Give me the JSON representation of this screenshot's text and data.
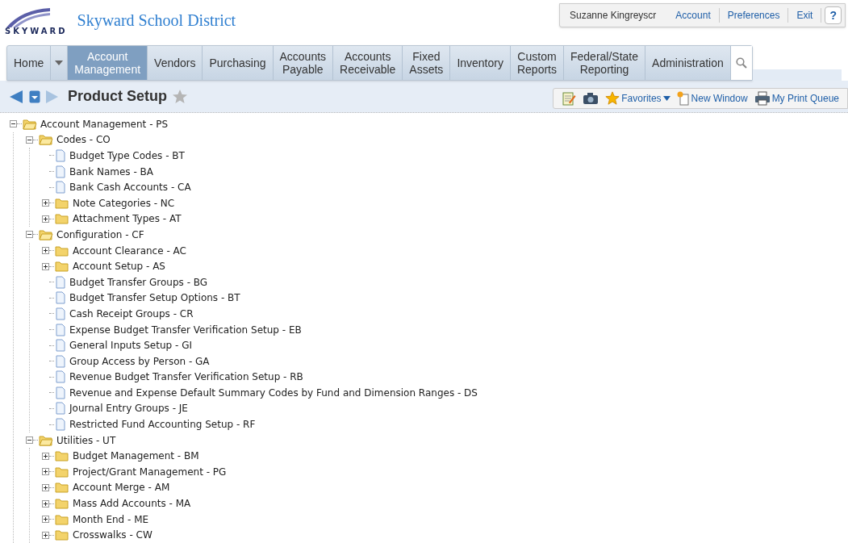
{
  "header": {
    "district": "Skyward School District",
    "logo_text": "SKYWARD",
    "user": "Suzanne Kingreyscr",
    "links": [
      "Account",
      "Preferences",
      "Exit"
    ],
    "help": "?"
  },
  "nav": {
    "tabs": [
      {
        "label": "Home",
        "selected": false,
        "dropdown": true
      },
      {
        "label": "Account Management",
        "selected": true
      },
      {
        "label": "Vendors",
        "selected": false
      },
      {
        "label": "Purchasing",
        "selected": false
      },
      {
        "label": "Accounts Payable",
        "selected": false
      },
      {
        "label": "Accounts Receivable",
        "selected": false
      },
      {
        "label": "Fixed Assets",
        "selected": false
      },
      {
        "label": "Inventory",
        "selected": false
      },
      {
        "label": "Custom Reports",
        "selected": false
      },
      {
        "label": "Federal/State Reporting",
        "selected": false
      },
      {
        "label": "Administration",
        "selected": false
      }
    ]
  },
  "page": {
    "title": "Product Setup",
    "favorited": false
  },
  "toolbar": [
    {
      "kind": "notes"
    },
    {
      "kind": "camera"
    },
    {
      "kind": "favorites",
      "label": "Favorites"
    },
    {
      "kind": "window",
      "label": "New Window"
    },
    {
      "kind": "print",
      "label": "My Print Queue"
    }
  ],
  "tree": [
    {
      "label": "Account Management - PS",
      "kind": "folder",
      "expanded": true,
      "children": [
        {
          "label": "Codes - CO",
          "kind": "folder",
          "expanded": true,
          "children": [
            {
              "label": "Budget Type Codes - BT",
              "kind": "page"
            },
            {
              "label": "Bank Names - BA",
              "kind": "page"
            },
            {
              "label": "Bank Cash Accounts - CA",
              "kind": "page"
            },
            {
              "label": "Note Categories - NC",
              "kind": "folder",
              "expanded": false
            },
            {
              "label": "Attachment Types - AT",
              "kind": "folder",
              "expanded": false
            }
          ]
        },
        {
          "label": "Configuration - CF",
          "kind": "folder",
          "expanded": true,
          "children": [
            {
              "label": "Account Clearance - AC",
              "kind": "folder",
              "expanded": false
            },
            {
              "label": "Account Setup - AS",
              "kind": "folder",
              "expanded": false
            },
            {
              "label": "Budget Transfer Groups - BG",
              "kind": "page"
            },
            {
              "label": "Budget Transfer Setup Options - BT",
              "kind": "page"
            },
            {
              "label": "Cash Receipt Groups - CR",
              "kind": "page"
            },
            {
              "label": "Expense Budget Transfer Verification Setup - EB",
              "kind": "page"
            },
            {
              "label": "General Inputs Setup - GI",
              "kind": "page"
            },
            {
              "label": "Group Access by Person - GA",
              "kind": "page"
            },
            {
              "label": "Revenue Budget Transfer Verification Setup - RB",
              "kind": "page"
            },
            {
              "label": "Revenue and Expense Default Summary Codes by Fund and Dimension Ranges - DS",
              "kind": "page"
            },
            {
              "label": "Journal Entry Groups - JE",
              "kind": "page"
            },
            {
              "label": "Restricted Fund Accounting Setup - RF",
              "kind": "page"
            }
          ]
        },
        {
          "label": "Utilities - UT",
          "kind": "folder",
          "expanded": true,
          "children": [
            {
              "label": "Budget Management - BM",
              "kind": "folder",
              "expanded": false
            },
            {
              "label": "Project/Grant Management - PG",
              "kind": "folder",
              "expanded": false
            },
            {
              "label": "Account Merge - AM",
              "kind": "folder",
              "expanded": false
            },
            {
              "label": "Mass Add Accounts - MA",
              "kind": "folder",
              "expanded": false
            },
            {
              "label": "Month End - ME",
              "kind": "folder",
              "expanded": false
            },
            {
              "label": "Crosswalks - CW",
              "kind": "folder",
              "expanded": false
            }
          ]
        }
      ]
    }
  ]
}
